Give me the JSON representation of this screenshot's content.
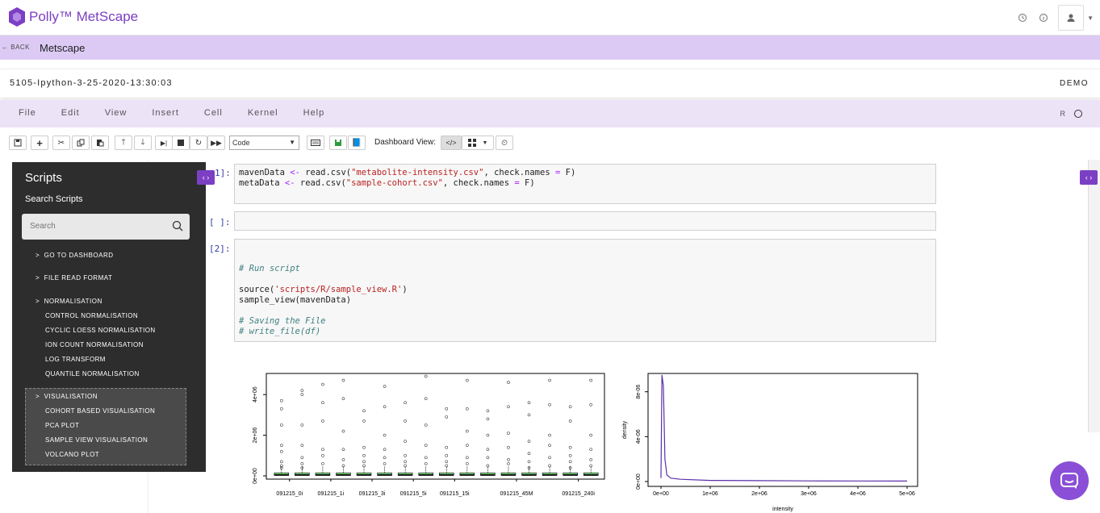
{
  "app": {
    "title": "Polly™ MetScape"
  },
  "back": {
    "label": "BACK",
    "title": "Metscape"
  },
  "notebook": {
    "name": "5105-Ipython-3-25-2020-13:30:03",
    "badge": "DEMO"
  },
  "menu": [
    "File",
    "Edit",
    "View",
    "Insert",
    "Cell",
    "Kernel",
    "Help"
  ],
  "kernel": {
    "label": "R"
  },
  "toolbar": {
    "cell_type": "Code",
    "dashboard_label": "Dashboard View:"
  },
  "sidebar": {
    "title": "Scripts",
    "search_title": "Search Scripts",
    "search_placeholder": "Search",
    "items": [
      {
        "label": "GO TO DASHBOARD"
      },
      {
        "label": "FILE READ FORMAT"
      },
      {
        "label": "NORMALISATION",
        "children": [
          "CONTROL NORMALISATION",
          "CYCLIC LOESS NORMALISATION",
          "ION COUNT NORMALISATION",
          "LOG TRANSFORM",
          "QUANTILE NORMALISATION"
        ]
      },
      {
        "label": "VISUALISATION",
        "children": [
          "COHORT BASED VISUALISATION",
          "PCA PLOT",
          "SAMPLE VIEW VISUALISATION",
          "VOLCANO PLOT"
        ]
      }
    ]
  },
  "cells": [
    {
      "prompt": "[1]:",
      "lines": [
        "mavenData <- read.csv(\"metabolite-intensity.csv\", check.names = F)",
        "metaData <- read.csv(\"sample-cohort.csv\", check.names = F)"
      ]
    },
    {
      "prompt": "[ ]:",
      "lines": [
        ""
      ]
    },
    {
      "prompt": "[2]:",
      "lines": [
        "",
        "",
        "# Run script",
        "",
        "source('scripts/R/sample_view.R')",
        "sample_view(mavenData)",
        "",
        "# Saving the File",
        "# write_file(df)"
      ]
    }
  ],
  "chart_data": [
    {
      "type": "box",
      "title": "",
      "xlabel": "",
      "ylabel": "",
      "yticks": [
        "0e+00",
        "2e+06",
        "4e+06"
      ],
      "xticks": [
        "091215_0i",
        "091215_1i",
        "091215_3i",
        "091215_5i",
        "091215_15i",
        "091215_45M",
        "091215_240i"
      ],
      "box_count": 16,
      "box_color": "#7ddb7d"
    },
    {
      "type": "line",
      "title": "",
      "xlabel": "intensity",
      "ylabel": "density",
      "xticks": [
        "0e+00",
        "1e+06",
        "2e+06",
        "3e+06",
        "4e+06",
        "5e+06"
      ],
      "yticks": [
        "0e+00",
        "4e-06",
        "8e-06"
      ],
      "line_color": "#5b2fa8",
      "x": [
        0,
        20000,
        50000,
        80000,
        120000,
        200000,
        400000,
        1000000,
        2000000,
        3000000,
        4000000,
        5000000
      ],
      "y": [
        3e-07,
        9.5e-06,
        8.5e-06,
        2e-06,
        6e-07,
        3e-07,
        2e-07,
        1e-07,
        8e-08,
        6e-08,
        5e-08,
        4e-08
      ]
    }
  ]
}
